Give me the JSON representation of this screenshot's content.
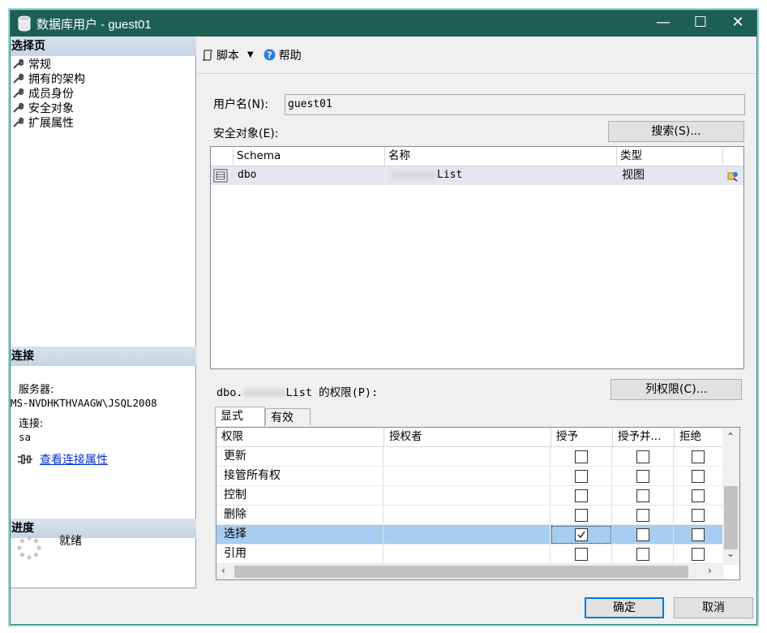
{
  "window": {
    "title": "数据库用户 - guest01"
  },
  "left": {
    "pages_header": "选择页",
    "pages": [
      "常规",
      "拥有的架构",
      "成员身份",
      "安全对象",
      "扩展属性"
    ],
    "connection_header": "连接",
    "server_label": "服务器:",
    "server_value": "MS-NVDHKTHVAAGW\\JSQL2008",
    "connection_label": "连接:",
    "connection_value": "sa",
    "view_conn_props": "查看连接属性",
    "progress_header": "进度",
    "progress_status": "就绪"
  },
  "toolbar": {
    "script_label": "脚本",
    "help_label": "帮助"
  },
  "main": {
    "username_label": "用户名(N):",
    "username_value": "guest01",
    "securables_label": "安全对象(E):",
    "search_button": "搜索(S)...",
    "securables_columns": [
      "Schema",
      "名称",
      "类型"
    ],
    "securables_rows": [
      {
        "schema": "dbo",
        "name": "List",
        "type": "视图"
      }
    ],
    "permissions_for_prefix": "dbo.",
    "permissions_for_suffix": "List 的权限(P):",
    "column_permissions_button": "列权限(C)...",
    "tabs": [
      "显式",
      "有效"
    ],
    "perm_columns": [
      "权限",
      "授权者",
      "授予",
      "授予并...",
      "拒绝"
    ],
    "perm_rows": [
      {
        "permission": "更新",
        "grantor": "",
        "grant": false,
        "with_grant": false,
        "deny": false
      },
      {
        "permission": "接管所有权",
        "grantor": "",
        "grant": false,
        "with_grant": false,
        "deny": false
      },
      {
        "permission": "控制",
        "grantor": "",
        "grant": false,
        "with_grant": false,
        "deny": false
      },
      {
        "permission": "删除",
        "grantor": "",
        "grant": false,
        "with_grant": false,
        "deny": false
      },
      {
        "permission": "选择",
        "grantor": "",
        "grant": true,
        "with_grant": false,
        "deny": false,
        "selected": true
      },
      {
        "permission": "引用",
        "grantor": "",
        "grant": false,
        "with_grant": false,
        "deny": false
      }
    ]
  },
  "footer": {
    "ok_button": "确定",
    "cancel_button": "取消"
  }
}
